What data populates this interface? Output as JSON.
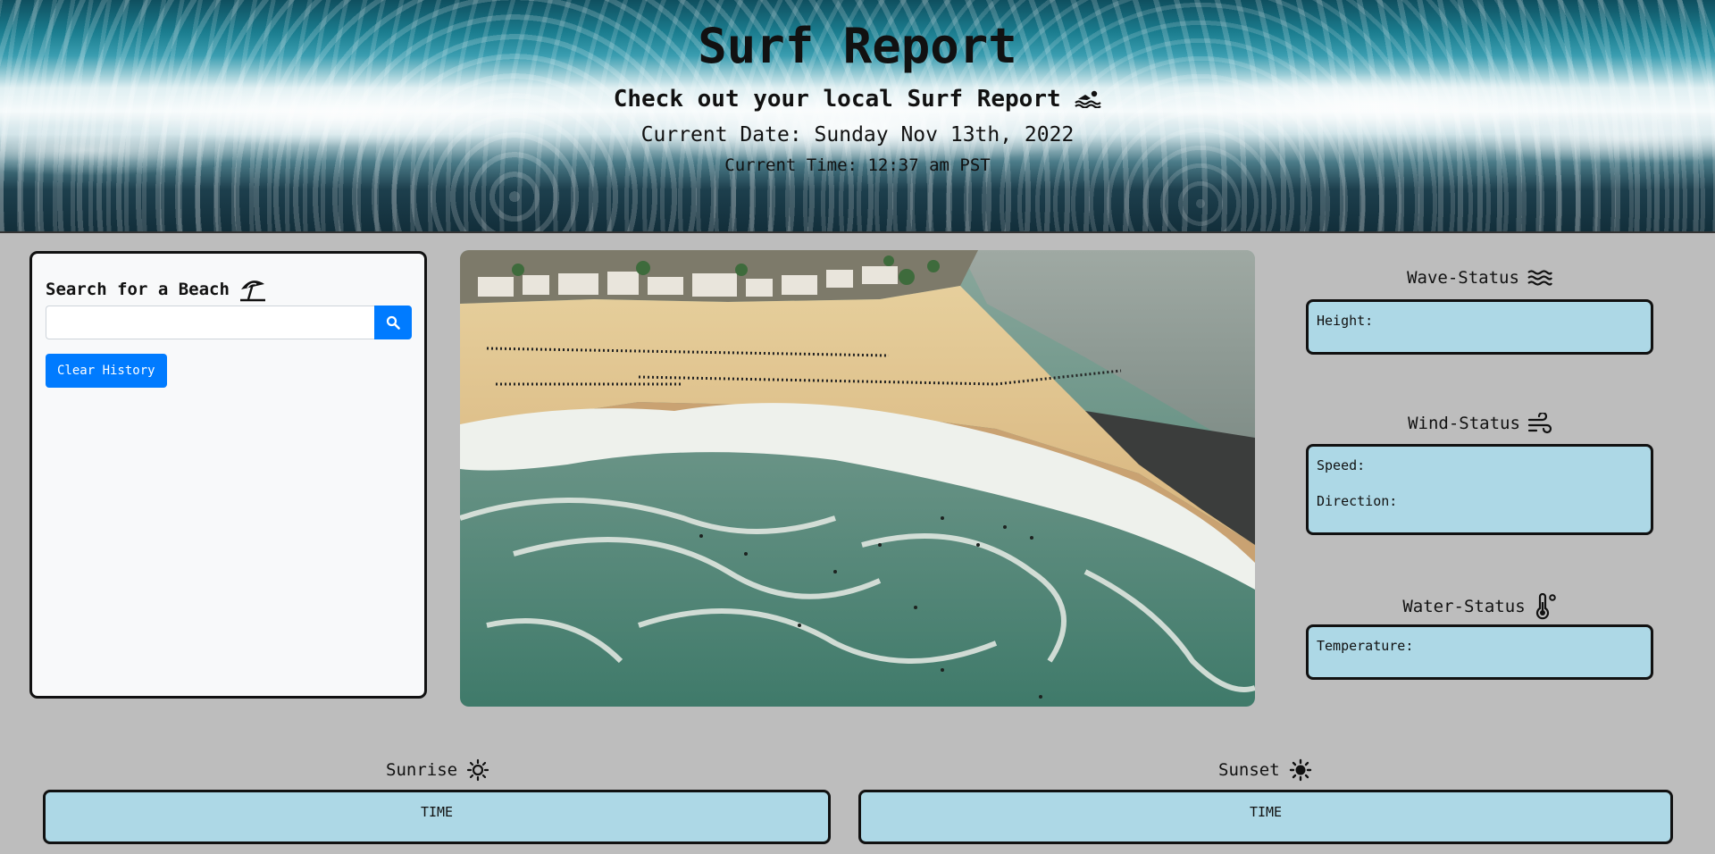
{
  "header": {
    "title": "Surf Report",
    "subtitle": "Check out your local Surf Report",
    "date_label": "Current Date:",
    "date_value": "Sunday Nov 13th, 2022",
    "time_label": "Current Time:",
    "time_value": "12:37 am PST"
  },
  "search": {
    "heading": "Search for a Beach",
    "input_value": "",
    "input_placeholder": "",
    "clear_label": "Clear History"
  },
  "status": {
    "wave": {
      "title": "Wave-Status",
      "height_label": "Height:"
    },
    "wind": {
      "title": "Wind-Status",
      "speed_label": "Speed:",
      "direction_label": "Direction:"
    },
    "water": {
      "title": "Water-Status",
      "temperature_label": "Temperature:"
    }
  },
  "sun": {
    "sunrise": {
      "title": "Sunrise",
      "value": "TIME"
    },
    "sunset": {
      "title": "Sunset",
      "value": "TIME"
    }
  },
  "icons": {
    "swimmer": "swimmer-icon",
    "umbrella": "beach-umbrella-icon",
    "search": "search-icon",
    "waves": "water-waves-icon",
    "wind": "wind-icon",
    "thermometer": "thermometer-icon",
    "sunrise": "sun-outline-icon",
    "sunset": "sun-filled-icon"
  },
  "colors": {
    "page_bg": "#bdbdbd",
    "card_bg": "#add8e6",
    "button_bg": "#007bff",
    "panel_bg": "#f8f9fa"
  }
}
